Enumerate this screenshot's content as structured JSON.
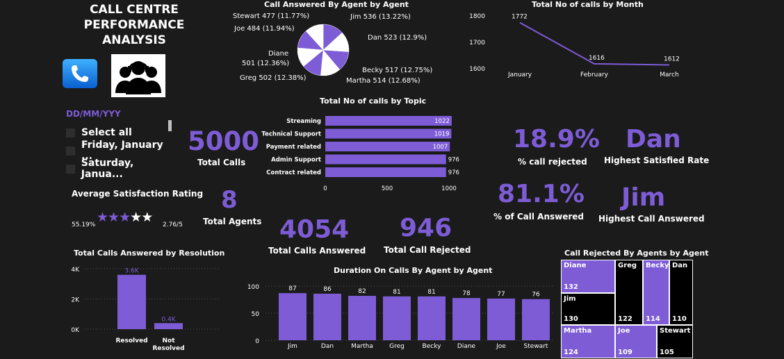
{
  "header": {
    "title_line1": "CALL CENTRE",
    "title_line2": "PERFORMANCE",
    "title_line3": "ANALYSIS"
  },
  "icons": {
    "phone": "phone-icon",
    "agents": "headset-agents-icon"
  },
  "slicer": {
    "header": "DD/MM/YYY",
    "items": [
      "Select all",
      "Friday, January ...",
      "Saturday, Janua..."
    ]
  },
  "rating": {
    "title": "Average Satisfaction Rating",
    "percent": "55.19%",
    "score_text": "2.76/5",
    "stars_filled": 3,
    "stars_total": 5
  },
  "kpis": {
    "total_calls": {
      "value": "5000",
      "label": "Total Calls"
    },
    "total_agents": {
      "value": "8",
      "label": "Total Agents"
    },
    "answered": {
      "value": "4054",
      "label": "Total Calls Answered"
    },
    "rejected": {
      "value": "946",
      "label": "Total Call Rejected"
    },
    "pct_rejected": {
      "value": "18.9%",
      "label": "% call rejected"
    },
    "pct_answered": {
      "value": "81.1%",
      "label": "% of Call Answered"
    },
    "top_satisfied": {
      "value": "Dan",
      "label": "Highest Satisfied Rate"
    },
    "top_answered": {
      "value": "Jim",
      "label": "Highest Call Answered"
    }
  },
  "colors": {
    "purple": "#7d5cd6",
    "background": "#1b1b1b"
  },
  "chart_data": [
    {
      "id": "pie",
      "type": "pie",
      "title": "Call Answered By Agent by Agent",
      "slices": [
        {
          "label": "Jim 536 (13.22%)",
          "value": 536
        },
        {
          "label": "Dan 523 (12.9%)",
          "value": 523
        },
        {
          "label": "Becky 517 (12.75%)",
          "value": 517
        },
        {
          "label": "Martha 514 (12.68%)",
          "value": 514
        },
        {
          "label": "Greg 502 (12.38%)",
          "value": 502
        },
        {
          "label": "Diane 501 (12.36%)",
          "value": 501
        },
        {
          "label": "Joe 484 (11.94%)",
          "value": 484
        },
        {
          "label": "Stewart 477 (11.77%)",
          "value": 477
        }
      ],
      "diane_label_lines": [
        "Diane",
        "501 (12.36%)"
      ]
    },
    {
      "id": "line",
      "type": "line",
      "title": "Total No of calls by Month",
      "categories": [
        "January",
        "February",
        "March"
      ],
      "values": [
        1772,
        1616,
        1612
      ],
      "yticks": [
        "1800",
        "1700",
        "1600"
      ],
      "ylim": [
        1600,
        1800
      ]
    },
    {
      "id": "hbar",
      "type": "bar",
      "title": "Total No of calls by Topic",
      "categories": [
        "Streaming",
        "Technical Support",
        "Payment related",
        "Admin Support",
        "Contract related"
      ],
      "values": [
        1022,
        1019,
        1007,
        976,
        976
      ],
      "xticks": [
        "0",
        "500",
        "1000"
      ],
      "xlim": [
        0,
        1000
      ]
    },
    {
      "id": "resolution",
      "type": "bar",
      "title": "Total Calls Answered by Resolution",
      "categories": [
        "Resolved",
        "Not Resolved"
      ],
      "category_lines": [
        [
          "Resolved"
        ],
        [
          "Not",
          "Resolved"
        ]
      ],
      "values": [
        3600,
        400
      ],
      "data_labels": [
        "3.6K",
        "0.4K"
      ],
      "yticks": [
        "4K",
        "2K",
        "0K"
      ],
      "ylim": [
        0,
        4000
      ]
    },
    {
      "id": "duration",
      "type": "bar",
      "title": "Duration On Calls By Agent by Agent",
      "categories": [
        "Jim",
        "Dan",
        "Martha",
        "Greg",
        "Becky",
        "Diane",
        "Joe",
        "Stewart"
      ],
      "values": [
        87,
        86,
        82,
        81,
        81,
        78,
        77,
        76
      ],
      "yticks": [
        "100",
        "50",
        "0"
      ],
      "ylim": [
        0,
        100
      ]
    },
    {
      "id": "treemap",
      "type": "treemap",
      "title": "Call Rejected By Agents by Agent",
      "items": [
        {
          "label": "Diane",
          "value": 132,
          "value_text": "132"
        },
        {
          "label": "Jim",
          "value": 130,
          "value_text": "130"
        },
        {
          "label": "Martha",
          "value": 124,
          "value_text": "124"
        },
        {
          "label": "Greg",
          "value": 122,
          "value_text": "122"
        },
        {
          "label": "Joe",
          "value": 109,
          "value_text": "109"
        },
        {
          "label": "Becky",
          "value": 114,
          "value_text": "114"
        },
        {
          "label": "Dan",
          "value": 110,
          "value_text": "110"
        },
        {
          "label": "Stewart",
          "value": 105,
          "value_text": "105"
        }
      ]
    }
  ]
}
